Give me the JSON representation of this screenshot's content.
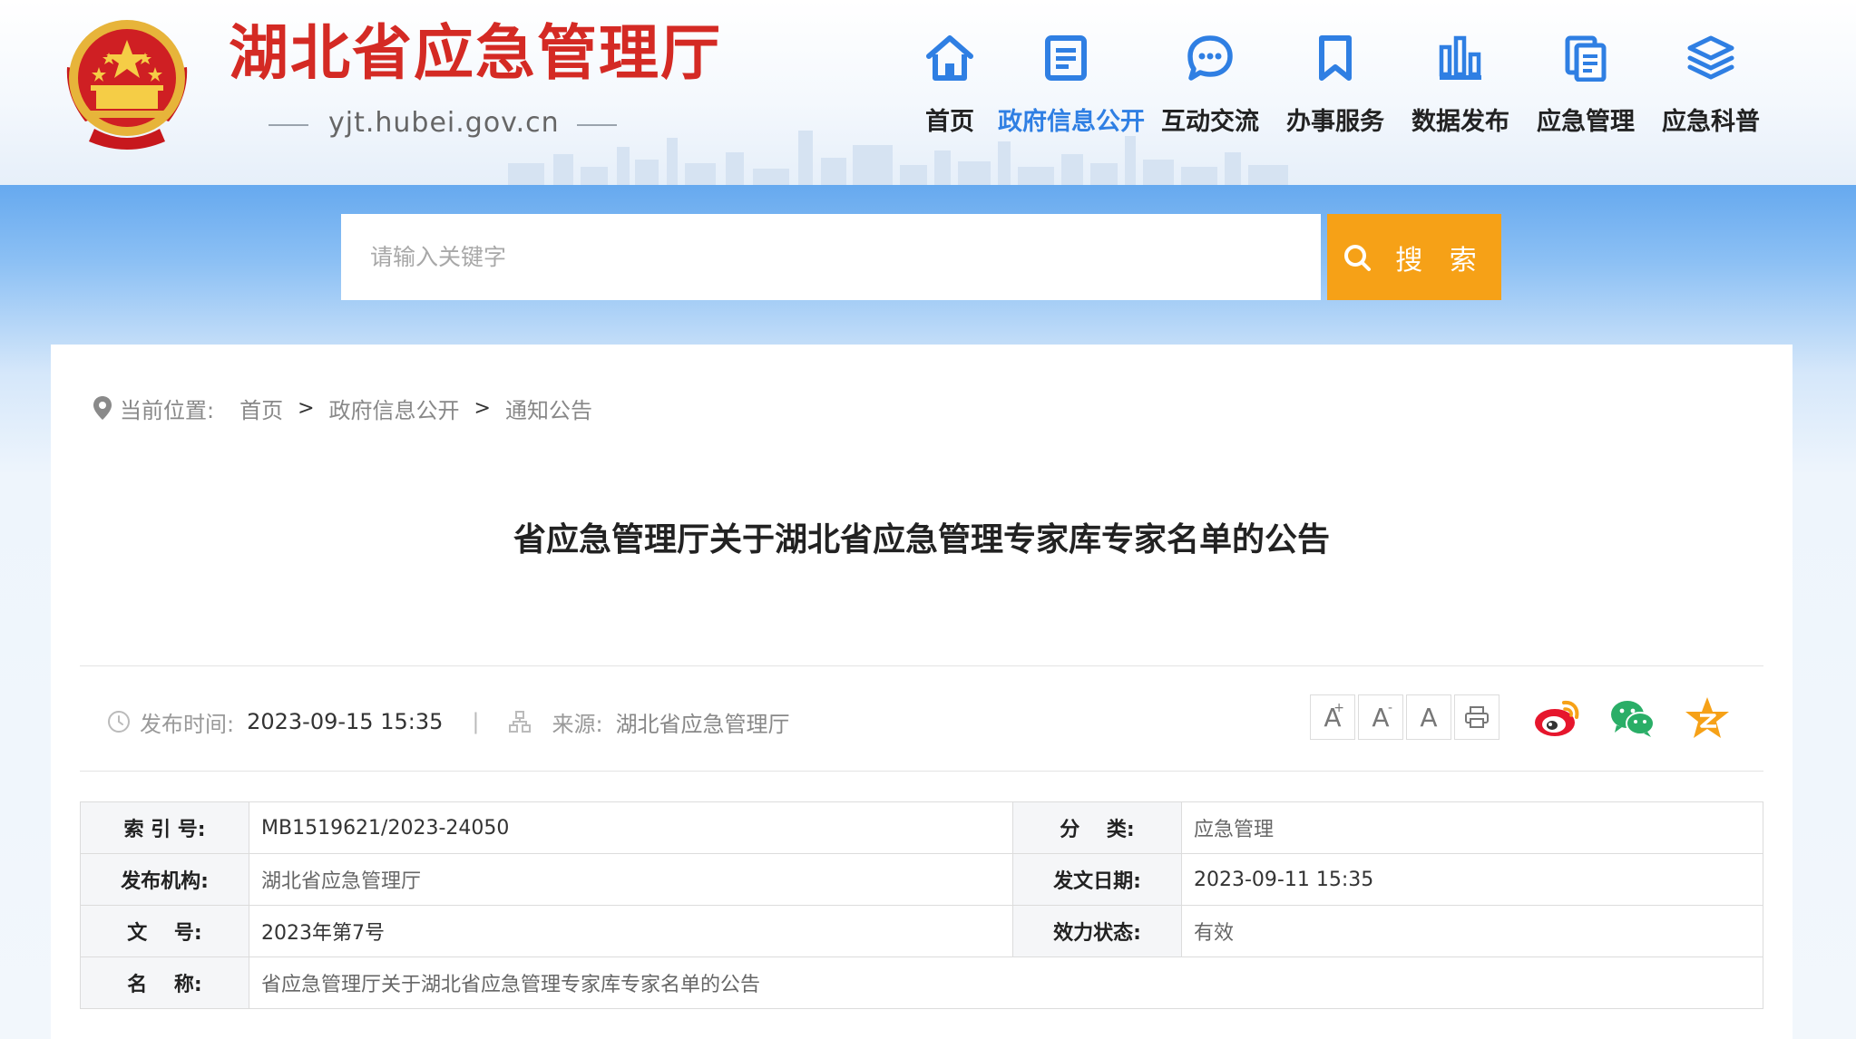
{
  "site": {
    "title": "湖北省应急管理厅",
    "domain": "yjt.hubei.gov.cn"
  },
  "nav": {
    "items": [
      {
        "label": "首页",
        "icon": "home-icon"
      },
      {
        "label": "政府信息公开",
        "icon": "document-list-icon",
        "active": true
      },
      {
        "label": "互动交流",
        "icon": "chat-bubble-icon"
      },
      {
        "label": "办事服务",
        "icon": "bookmark-icon"
      },
      {
        "label": "数据发布",
        "icon": "bar-chart-icon"
      },
      {
        "label": "应急管理",
        "icon": "copy-document-icon"
      },
      {
        "label": "应急科普",
        "icon": "layers-icon"
      }
    ]
  },
  "search": {
    "placeholder": "请输入关键字",
    "button_label": "搜 索"
  },
  "breadcrumb": {
    "label": "当前位置:",
    "items": [
      "首页",
      "政府信息公开",
      "通知公告"
    ],
    "separator": ">"
  },
  "article": {
    "title": "省应急管理厅关于湖北省应急管理专家库专家名单的公告",
    "publish_label": "发布时间:",
    "publish_time": "2023-09-15 15:35",
    "meta_separator": "|",
    "source_label": "来源:",
    "source": "湖北省应急管理厅"
  },
  "tools": {
    "font_increase": "A",
    "font_increase_mark": "+",
    "font_decrease": "A",
    "font_decrease_mark": "-",
    "font_reset": "A"
  },
  "share": [
    "weibo-icon",
    "wechat-icon",
    "qzone-icon"
  ],
  "info": {
    "index_label": "索 引 号:",
    "index_value": "MB1519621/2023-24050",
    "category_label": "分　 类:",
    "category_value": "应急管理",
    "issuer_label": "发布机构:",
    "issuer_value": "湖北省应急管理厅",
    "date_label": "发文日期:",
    "date_value": "2023-09-11 15:35",
    "doc_no_label": "文　 号:",
    "doc_no_value": "2023年第7号",
    "status_label": "效力状态:",
    "status_value": "有效",
    "name_label": "名　 称:",
    "name_value": "省应急管理厅关于湖北省应急管理专家库专家名单的公告"
  },
  "colors": {
    "brand_red": "#d42a24",
    "nav_active": "#2f7fe3",
    "search_button": "#f6a117",
    "icon_blue": "#2f7fe3"
  }
}
